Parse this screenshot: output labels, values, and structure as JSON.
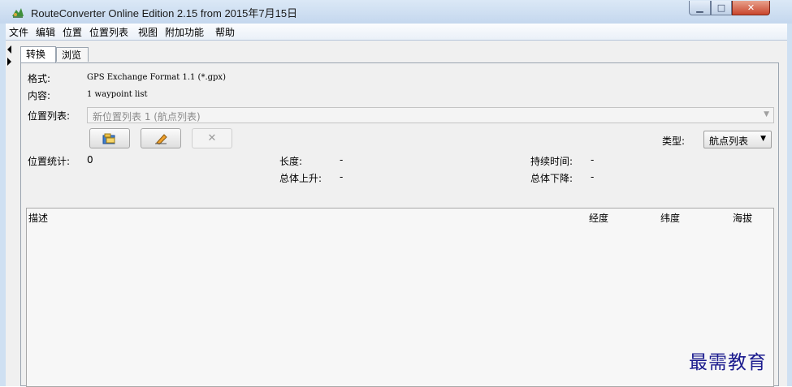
{
  "window": {
    "title": "RouteConverter Online Edition 2.15 from 2015年7月15日",
    "minimize_glyph": "▁",
    "maximize_glyph": "□",
    "close_glyph": "✕"
  },
  "menu": [
    "文件",
    "编辑",
    "位置",
    "位置列表",
    "视图",
    "附加功能",
    "帮助"
  ],
  "tabs": [
    {
      "label": "转换",
      "active": true
    },
    {
      "label": "浏览",
      "active": false
    }
  ],
  "form": {
    "format_label": "格式:",
    "format_value": "GPS Exchange Format 1.1 (*.gpx)",
    "content_label": "内容:",
    "content_value": "1 waypoint list",
    "position_list_label": "位置列表:",
    "position_list_value": "新位置列表 1 (航点列表)"
  },
  "toolbar": {
    "open_icon": "folder-open-icon",
    "edit_icon": "pencil-icon",
    "delete_icon": "delete-x-icon",
    "delete_glyph": "✕"
  },
  "type_select": {
    "label": "类型:",
    "value": "航点列表"
  },
  "stats": {
    "count_label": "位置统计:",
    "count_value": "0",
    "length_label": "长度:",
    "length_value": "-",
    "ascent_label": "总体上升:",
    "ascent_value": "-",
    "duration_label": "持续时间:",
    "duration_value": "-",
    "descent_label": "总体下降:",
    "descent_value": "-"
  },
  "table": {
    "columns": [
      "描述",
      "经度",
      "纬度",
      "海拔"
    ],
    "rows": []
  },
  "watermark": "最需教育",
  "colors": {
    "title_bar": "#c4d7ee",
    "close_button": "#c9452c",
    "watermark": "#1b1b8e"
  }
}
